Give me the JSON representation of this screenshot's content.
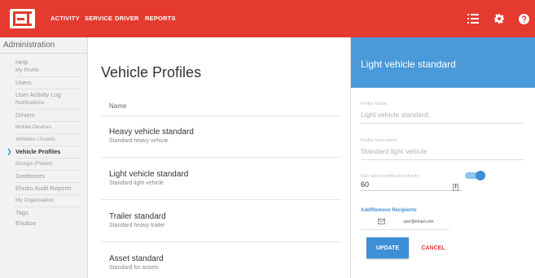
{
  "topnav": {
    "links": [
      "ACTIVITY",
      "SERVICE",
      "DRIVER",
      "REPORTS"
    ],
    "icons": [
      "list-icon",
      "gear-icon",
      "help-icon"
    ]
  },
  "sidebar": {
    "title": "Administration",
    "items": [
      {
        "label": "Help"
      },
      {
        "label": "My Profile"
      },
      {
        "label": "Users"
      },
      {
        "label": "User Activity Log"
      },
      {
        "label": "Notifications"
      },
      {
        "label": "Drivers"
      },
      {
        "label": "Mobile Devices"
      },
      {
        "label": "Vehicles / Assets"
      },
      {
        "label": "Vehicle Profiles",
        "active": true
      },
      {
        "label": "Groups (Fleets)"
      },
      {
        "label": "Geofences"
      },
      {
        "label": "Ehubo Audit Reports"
      },
      {
        "label": "My Organisation"
      },
      {
        "label": "Tags"
      },
      {
        "label": "Ehubos"
      }
    ]
  },
  "main": {
    "title": "Vehicle Profiles",
    "column_header": "Name",
    "profiles": [
      {
        "name": "Heavy vehicle standard",
        "description": "Standard heavy vehicle"
      },
      {
        "name": "Light vehicle standard",
        "description": "Standard light vehicle"
      },
      {
        "name": "Trailer standard",
        "description": "Standard heavy trailer"
      },
      {
        "name": "Asset standard",
        "description": "Standard for assets"
      }
    ]
  },
  "panel": {
    "title": "Light vehicle standard",
    "profile_name_label": "Profile Name",
    "profile_name_value": "Light vehicle standard",
    "profile_description_label": "Profile Description",
    "profile_description_value": "Standard light vehicle",
    "max_speed_label": "Max speed notification (km/h)",
    "max_speed_value": "60",
    "max_speed_enabled": true,
    "recipients_label": "Add/Remove Recipients",
    "recipient_email": "user@email.com",
    "update_label": "UPDATE",
    "cancel_label": "CANCEL"
  },
  "colors": {
    "brand_red": "#e53a30",
    "accent_blue": "#3d8fd6",
    "panel_header_blue": "#4a9ad9"
  }
}
